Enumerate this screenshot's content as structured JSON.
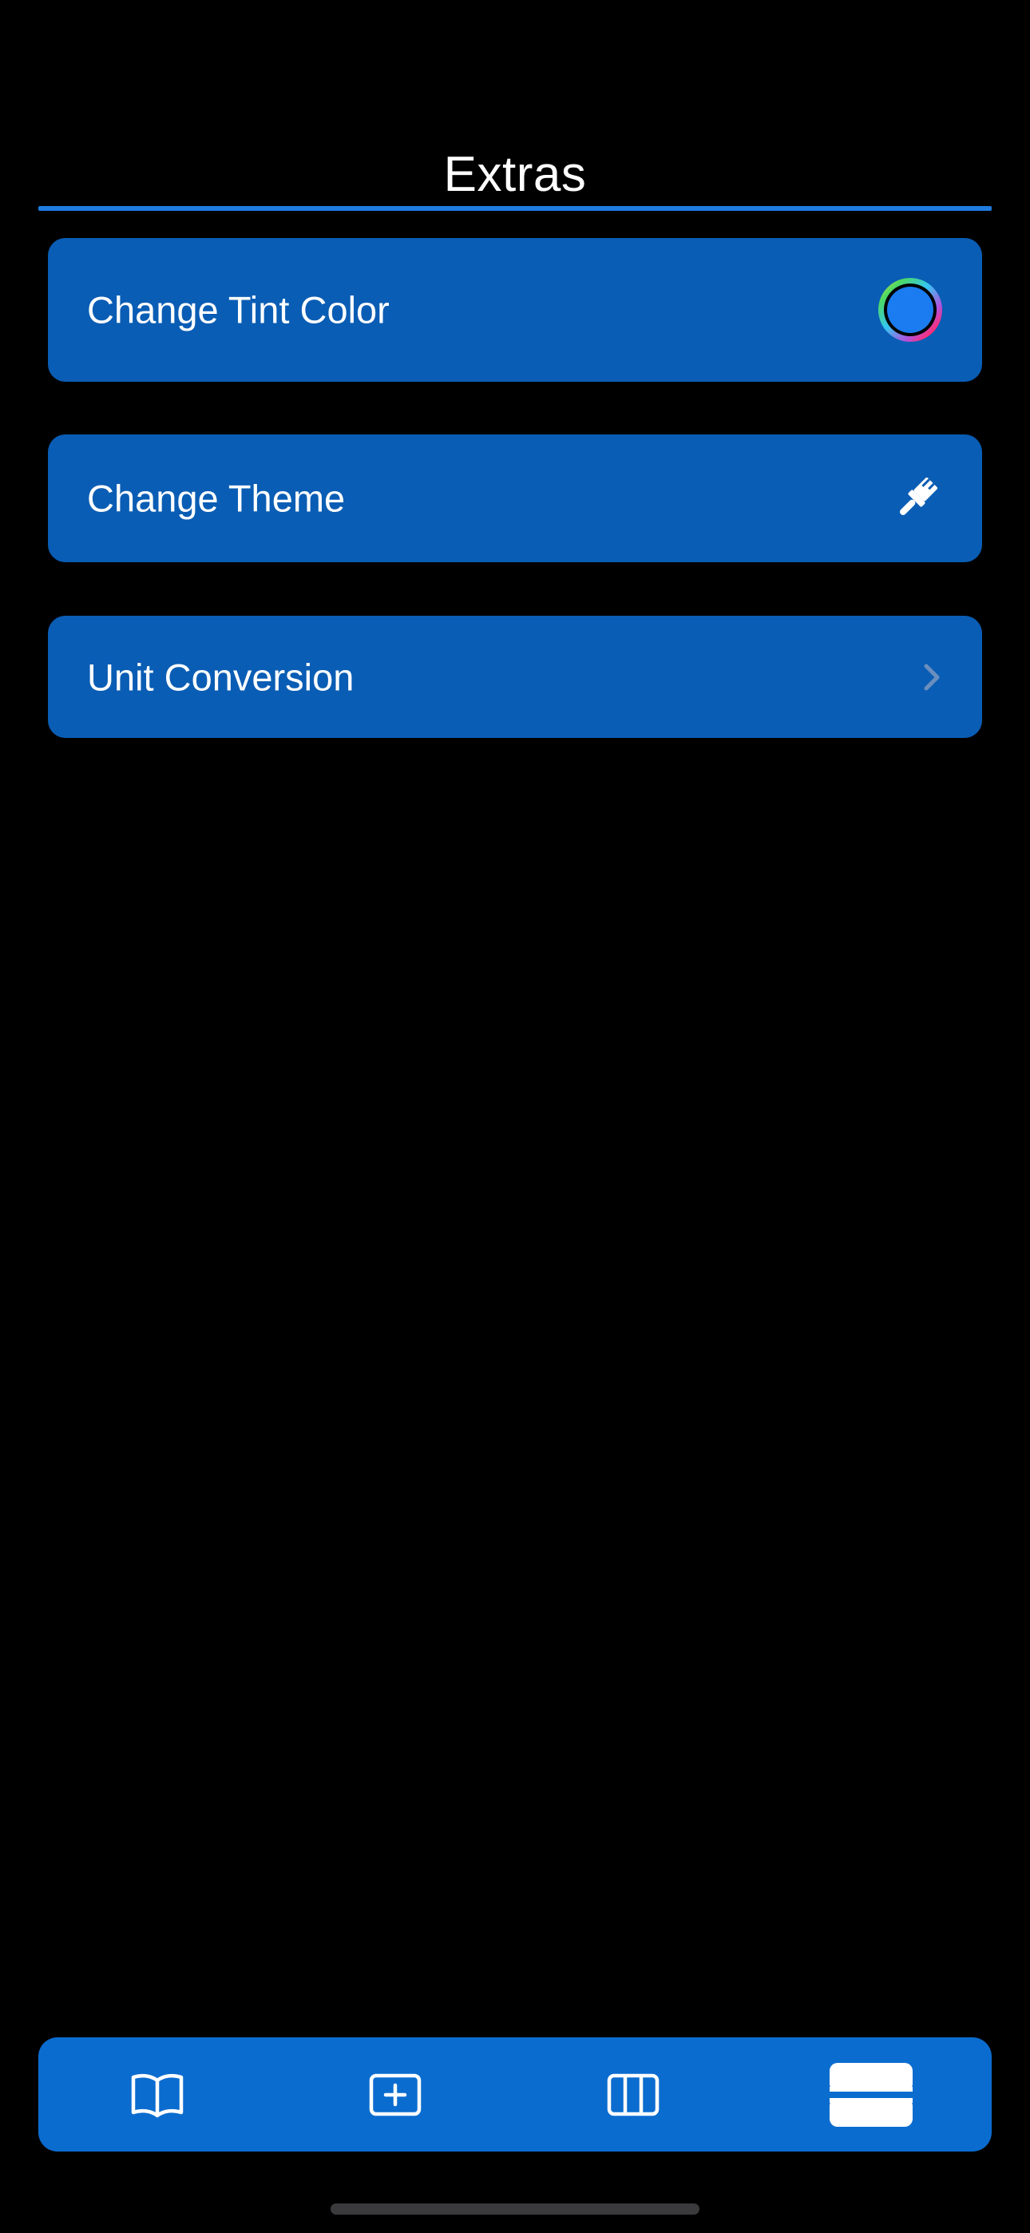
{
  "nav": {
    "title": "Extras"
  },
  "rows": [
    {
      "label": "Change Tint Color",
      "icon": "color-wheel-icon"
    },
    {
      "label": "Change Theme",
      "icon": "paintbrush-icon"
    },
    {
      "label": "Unit Conversion",
      "icon": "chevron-right-icon"
    }
  ],
  "tab_bar": {
    "tabs": [
      {
        "icon": "book-icon",
        "selected": false
      },
      {
        "icon": "plus-square-icon",
        "selected": false
      },
      {
        "icon": "columns-icon",
        "selected": false
      },
      {
        "icon": "rows-icon",
        "selected": true
      }
    ]
  },
  "colors": {
    "background": "#000000",
    "accent": "#1f7be0",
    "row_fill": "#0a5db4",
    "tab_bar_fill": "#0b6ccf",
    "tint_swatch": "#1a7cf0",
    "text": "#ffffff"
  }
}
